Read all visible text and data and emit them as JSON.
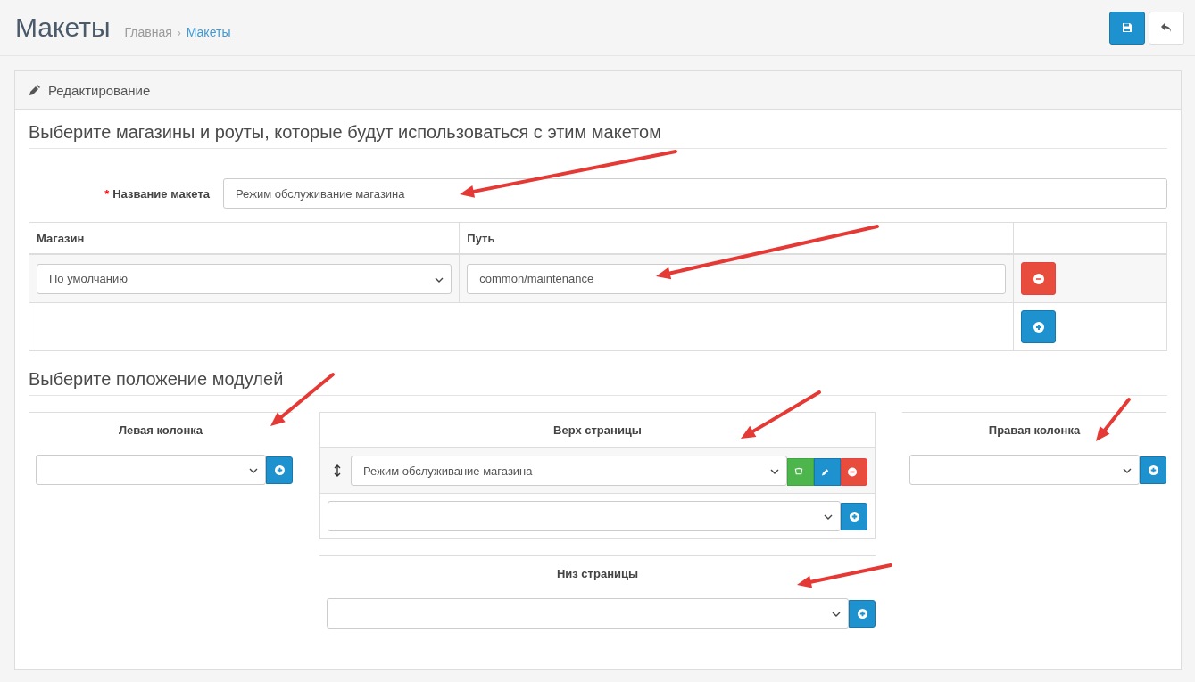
{
  "page": {
    "title": "Макеты",
    "breadcrumb_separator": "›",
    "breadcrumbs": [
      {
        "label": "Главная",
        "selected": false
      },
      {
        "label": "Макеты",
        "selected": true
      }
    ]
  },
  "panel": {
    "title": "Редактирование"
  },
  "routes_section": {
    "heading": "Выберите магазины и роуты, которые будут использоваться с этим макетом",
    "name_field": {
      "required_mark": "*",
      "label": "Название макета",
      "value": "Режим обслуживание магазина"
    },
    "table": {
      "columns": [
        "Магазин",
        "Путь"
      ],
      "rows": [
        {
          "store": "По умолчанию",
          "route": "common/maintenance"
        }
      ]
    }
  },
  "modules_section": {
    "heading": "Выберите положение модулей",
    "positions": [
      {
        "kind": "left",
        "title": "Левая колонка"
      },
      {
        "kind": "top",
        "title": "Верх страницы",
        "modules": [
          {
            "name": "Режим обслуживание магазина"
          }
        ]
      },
      {
        "kind": "right",
        "title": "Правая колонка"
      },
      {
        "kind": "bottom",
        "title": "Низ страницы"
      }
    ]
  }
}
